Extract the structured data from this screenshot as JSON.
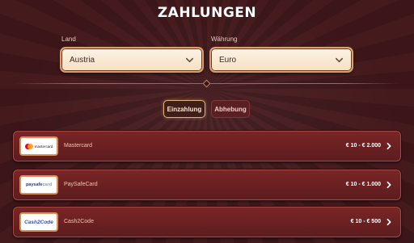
{
  "page": {
    "title": "ZAHLUNGEN"
  },
  "filters": {
    "country_label": "Land",
    "country_value": "Austria",
    "currency_label": "Währung",
    "currency_value": "Euro"
  },
  "tabs": [
    {
      "label": "Einzahlung",
      "active": true
    },
    {
      "label": "Abhebung",
      "active": false
    }
  ],
  "methods": [
    {
      "name": "Mastercard",
      "logo_text": "mastercard",
      "range": "€ 10 - € 2.000"
    },
    {
      "name": "PaySafeCard",
      "logo_text_a": "paysafe",
      "logo_text_b": "card",
      "range": "€ 10 - € 1.000"
    },
    {
      "name": "Cash2Code",
      "logo_text": "Cash2Code",
      "range": "€ 10 - € 500"
    }
  ],
  "colors": {
    "background": "#3a1417",
    "accent_gold": "#e4b173",
    "row_bg": "#6b2022"
  },
  "icons": {
    "dropdown": "chevron-down-icon",
    "row_action": "chevron-right-icon"
  }
}
